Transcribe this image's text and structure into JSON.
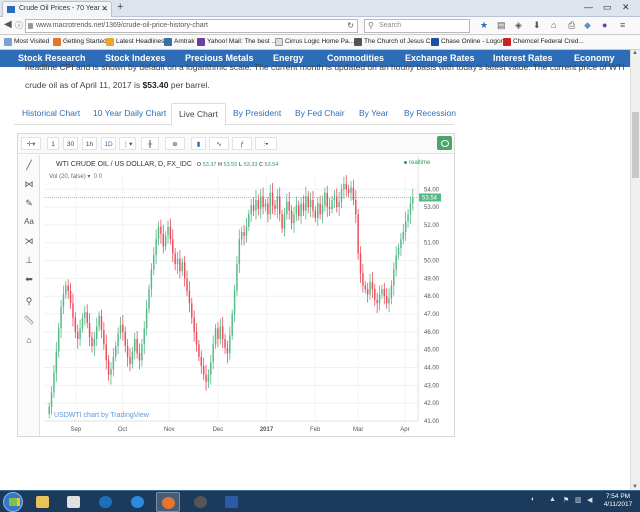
{
  "browser": {
    "tab_title": "Crude Oil Prices - 70 Year ...",
    "url": "www.macrotrends.net/1369/crude-oil-price-history-chart",
    "search_placeholder": "Search",
    "bookmarks": [
      "Most Visited",
      "Getting Started",
      "Latest Headlines",
      "Amtrak",
      "Yahoo! Mail: The best ...",
      "Cirrus Logic Home Pa...",
      "The Church of Jesus C...",
      "Chase Online - Logon",
      "Chemcel Federal Cred..."
    ]
  },
  "site_nav": [
    "Stock Research",
    "Stock Indexes",
    "Precious Metals",
    "Energy",
    "Commodities",
    "Exchange Rates",
    "Interest Rates",
    "Economy"
  ],
  "description": {
    "line1": "headline CPI and is shown by default on a logarithmic scale. The current month is updated on an hourly basis with today's latest value. The current price of WTI",
    "line2_prefix": "crude oil as of April 11, 2017 is ",
    "price": "$53.40",
    "line2_suffix": " per barrel."
  },
  "page_tabs": [
    "Historical Chart",
    "10 Year Daily Chart",
    "Live Chart",
    "By President",
    "By Fed Chair",
    "By Year",
    "By Recession"
  ],
  "active_tab": "Live Chart",
  "chart_toolbar": {
    "intervals": [
      "1",
      "30",
      "1h",
      "1D"
    ]
  },
  "chart_data": {
    "type": "candlestick",
    "title": "WTI CRUDE OIL / US DOLLAR, D, FX_IDC",
    "ohlc_o_label": "O",
    "ohlc_o": "53.37",
    "ohlc_h_label": "H",
    "ohlc_h": "53.55",
    "ohlc_l_label": "L",
    "ohlc_l": "53.33",
    "ohlc_c_label": "C",
    "ohlc_c": "53.54",
    "volume_label": "Vol (20, false)",
    "volume_value": "0 0",
    "realtime_label": "realtime",
    "last_price": "53.54",
    "ylim": [
      41,
      54.8
    ],
    "y_ticks": [
      "54.00",
      "53.00",
      "52.00",
      "51.00",
      "50.00",
      "49.00",
      "48.00",
      "47.00",
      "46.00",
      "45.00",
      "44.00",
      "43.00",
      "42.00",
      "41.00"
    ],
    "x_ticks": [
      "Sep",
      "Oct",
      "Nov",
      "Dec",
      "2017",
      "Feb",
      "Mar",
      "Apr"
    ],
    "attribution": "USDWTI chart by TradingView",
    "closes": [
      41.8,
      42.6,
      43.7,
      44.9,
      46.2,
      47.4,
      48.1,
      48.6,
      48.3,
      47.6,
      46.8,
      46.0,
      45.6,
      46.2,
      46.8,
      47.1,
      46.5,
      45.7,
      45.2,
      45.6,
      46.3,
      46.9,
      46.1,
      45.3,
      44.4,
      43.6,
      43.9,
      44.6,
      45.2,
      45.9,
      46.4,
      46.0,
      45.2,
      44.6,
      44.2,
      44.9,
      45.6,
      44.8,
      44.4,
      45.3,
      46.2,
      47.3,
      48.4,
      49.5,
      50.3,
      51.2,
      51.9,
      51.5,
      50.8,
      51.4,
      51.9,
      51.2,
      50.4,
      49.8,
      50.1,
      49.4,
      49.9,
      49.0,
      48.3,
      47.6,
      46.8,
      46.0,
      45.3,
      44.6,
      44.1,
      43.6,
      43.2,
      43.6,
      44.3,
      45.3,
      46.2,
      45.6,
      46.3,
      45.6,
      45.1,
      44.8,
      45.8,
      47.0,
      48.3,
      49.8,
      51.2,
      51.6,
      51.4,
      51.9,
      52.6,
      53.1,
      52.8,
      53.4,
      52.9,
      53.6,
      53.0,
      53.2,
      52.6,
      53.8,
      53.1,
      52.9,
      53.6,
      52.6,
      51.8,
      52.6,
      53.3,
      52.8,
      52.1,
      52.6,
      53.1,
      52.5,
      53.2,
      52.8,
      53.6,
      53.0,
      53.4,
      52.8,
      52.4,
      53.2,
      52.6,
      53.1,
      53.8,
      53.0,
      52.9,
      53.4,
      53.6,
      53.0,
      53.3,
      54.0,
      54.3,
      54.0,
      53.8,
      54.1,
      53.4,
      52.6,
      50.4,
      49.3,
      48.6,
      48.4,
      48.1,
      48.8,
      48.4,
      47.8,
      47.6,
      48.1,
      48.4,
      48.0,
      47.6,
      47.9,
      48.6,
      49.5,
      50.3,
      50.7,
      51.2,
      51.6,
      52.2,
      52.6,
      53.2,
      53.54
    ]
  },
  "taskbar": {
    "time": "7:54 PM",
    "date": "4/11/2017"
  }
}
